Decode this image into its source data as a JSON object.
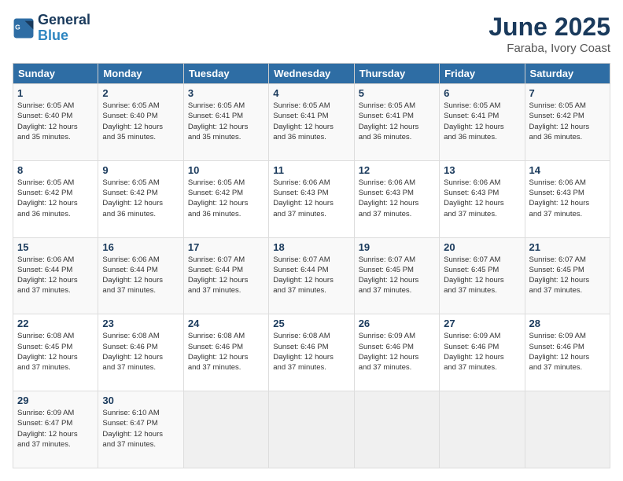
{
  "logo": {
    "line1": "General",
    "line2": "Blue"
  },
  "title": "June 2025",
  "subtitle": "Faraba, Ivory Coast",
  "days_of_week": [
    "Sunday",
    "Monday",
    "Tuesday",
    "Wednesday",
    "Thursday",
    "Friday",
    "Saturday"
  ],
  "weeks": [
    [
      {
        "day": "1",
        "info": "Sunrise: 6:05 AM\nSunset: 6:40 PM\nDaylight: 12 hours\nand 35 minutes."
      },
      {
        "day": "2",
        "info": "Sunrise: 6:05 AM\nSunset: 6:40 PM\nDaylight: 12 hours\nand 35 minutes."
      },
      {
        "day": "3",
        "info": "Sunrise: 6:05 AM\nSunset: 6:41 PM\nDaylight: 12 hours\nand 35 minutes."
      },
      {
        "day": "4",
        "info": "Sunrise: 6:05 AM\nSunset: 6:41 PM\nDaylight: 12 hours\nand 36 minutes."
      },
      {
        "day": "5",
        "info": "Sunrise: 6:05 AM\nSunset: 6:41 PM\nDaylight: 12 hours\nand 36 minutes."
      },
      {
        "day": "6",
        "info": "Sunrise: 6:05 AM\nSunset: 6:41 PM\nDaylight: 12 hours\nand 36 minutes."
      },
      {
        "day": "7",
        "info": "Sunrise: 6:05 AM\nSunset: 6:42 PM\nDaylight: 12 hours\nand 36 minutes."
      }
    ],
    [
      {
        "day": "8",
        "info": "Sunrise: 6:05 AM\nSunset: 6:42 PM\nDaylight: 12 hours\nand 36 minutes."
      },
      {
        "day": "9",
        "info": "Sunrise: 6:05 AM\nSunset: 6:42 PM\nDaylight: 12 hours\nand 36 minutes."
      },
      {
        "day": "10",
        "info": "Sunrise: 6:05 AM\nSunset: 6:42 PM\nDaylight: 12 hours\nand 36 minutes."
      },
      {
        "day": "11",
        "info": "Sunrise: 6:06 AM\nSunset: 6:43 PM\nDaylight: 12 hours\nand 37 minutes."
      },
      {
        "day": "12",
        "info": "Sunrise: 6:06 AM\nSunset: 6:43 PM\nDaylight: 12 hours\nand 37 minutes."
      },
      {
        "day": "13",
        "info": "Sunrise: 6:06 AM\nSunset: 6:43 PM\nDaylight: 12 hours\nand 37 minutes."
      },
      {
        "day": "14",
        "info": "Sunrise: 6:06 AM\nSunset: 6:43 PM\nDaylight: 12 hours\nand 37 minutes."
      }
    ],
    [
      {
        "day": "15",
        "info": "Sunrise: 6:06 AM\nSunset: 6:44 PM\nDaylight: 12 hours\nand 37 minutes."
      },
      {
        "day": "16",
        "info": "Sunrise: 6:06 AM\nSunset: 6:44 PM\nDaylight: 12 hours\nand 37 minutes."
      },
      {
        "day": "17",
        "info": "Sunrise: 6:07 AM\nSunset: 6:44 PM\nDaylight: 12 hours\nand 37 minutes."
      },
      {
        "day": "18",
        "info": "Sunrise: 6:07 AM\nSunset: 6:44 PM\nDaylight: 12 hours\nand 37 minutes."
      },
      {
        "day": "19",
        "info": "Sunrise: 6:07 AM\nSunset: 6:45 PM\nDaylight: 12 hours\nand 37 minutes."
      },
      {
        "day": "20",
        "info": "Sunrise: 6:07 AM\nSunset: 6:45 PM\nDaylight: 12 hours\nand 37 minutes."
      },
      {
        "day": "21",
        "info": "Sunrise: 6:07 AM\nSunset: 6:45 PM\nDaylight: 12 hours\nand 37 minutes."
      }
    ],
    [
      {
        "day": "22",
        "info": "Sunrise: 6:08 AM\nSunset: 6:45 PM\nDaylight: 12 hours\nand 37 minutes."
      },
      {
        "day": "23",
        "info": "Sunrise: 6:08 AM\nSunset: 6:46 PM\nDaylight: 12 hours\nand 37 minutes."
      },
      {
        "day": "24",
        "info": "Sunrise: 6:08 AM\nSunset: 6:46 PM\nDaylight: 12 hours\nand 37 minutes."
      },
      {
        "day": "25",
        "info": "Sunrise: 6:08 AM\nSunset: 6:46 PM\nDaylight: 12 hours\nand 37 minutes."
      },
      {
        "day": "26",
        "info": "Sunrise: 6:09 AM\nSunset: 6:46 PM\nDaylight: 12 hours\nand 37 minutes."
      },
      {
        "day": "27",
        "info": "Sunrise: 6:09 AM\nSunset: 6:46 PM\nDaylight: 12 hours\nand 37 minutes."
      },
      {
        "day": "28",
        "info": "Sunrise: 6:09 AM\nSunset: 6:46 PM\nDaylight: 12 hours\nand 37 minutes."
      }
    ],
    [
      {
        "day": "29",
        "info": "Sunrise: 6:09 AM\nSunset: 6:47 PM\nDaylight: 12 hours\nand 37 minutes."
      },
      {
        "day": "30",
        "info": "Sunrise: 6:10 AM\nSunset: 6:47 PM\nDaylight: 12 hours\nand 37 minutes."
      },
      {
        "day": "",
        "info": ""
      },
      {
        "day": "",
        "info": ""
      },
      {
        "day": "",
        "info": ""
      },
      {
        "day": "",
        "info": ""
      },
      {
        "day": "",
        "info": ""
      }
    ]
  ]
}
